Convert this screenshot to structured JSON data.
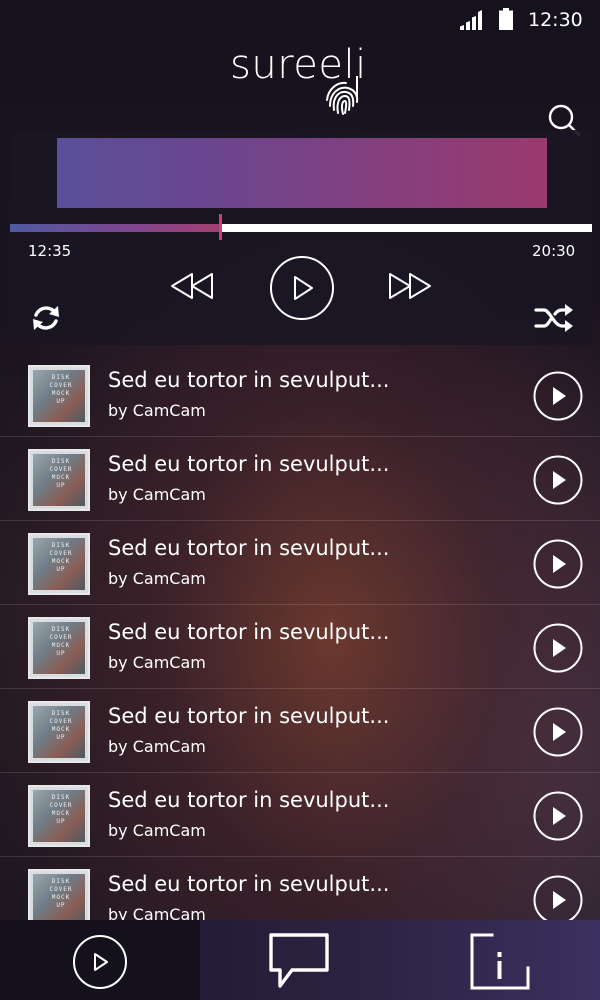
{
  "status_bar": {
    "time": "12:30",
    "signal_icon": "signal-bars-icon",
    "battery_icon": "battery-icon"
  },
  "header": {
    "logo_text": "sureeli",
    "logo_icon": "fingerprint-icon",
    "search_icon": "search-icon"
  },
  "player": {
    "elapsed": "12:35",
    "total": "20:30",
    "progress": 0.36,
    "controls": [
      "rewind-icon",
      "play-icon",
      "fast-forward-icon",
      "repeat-icon",
      "shuffle-icon"
    ]
  },
  "tracks": [
    {
      "title": "Sed eu tortor in sevulput...",
      "artist": "by CamCam"
    },
    {
      "title": "Sed eu tortor in sevulput...",
      "artist": "by CamCam"
    },
    {
      "title": "Sed eu tortor in sevulput...",
      "artist": "by CamCam"
    },
    {
      "title": "Sed eu tortor in sevulput...",
      "artist": "by CamCam"
    },
    {
      "title": "Sed eu tortor in sevulput...",
      "artist": "by CamCam"
    },
    {
      "title": "Sed eu tortor in sevulput...",
      "artist": "by CamCam"
    },
    {
      "title": "Sed eu tortor in sevulput...",
      "artist": "by CamCam"
    }
  ],
  "album_art_text": [
    "DISK",
    "COVER",
    "MOCK",
    "UP"
  ],
  "bottom_nav": {
    "items": [
      "play-icon",
      "chat-icon",
      "info-icon"
    ]
  },
  "colors": {
    "accent_pink": "#c4447a",
    "accent_blue": "#5a4f9a",
    "panel": "#1a1624"
  }
}
